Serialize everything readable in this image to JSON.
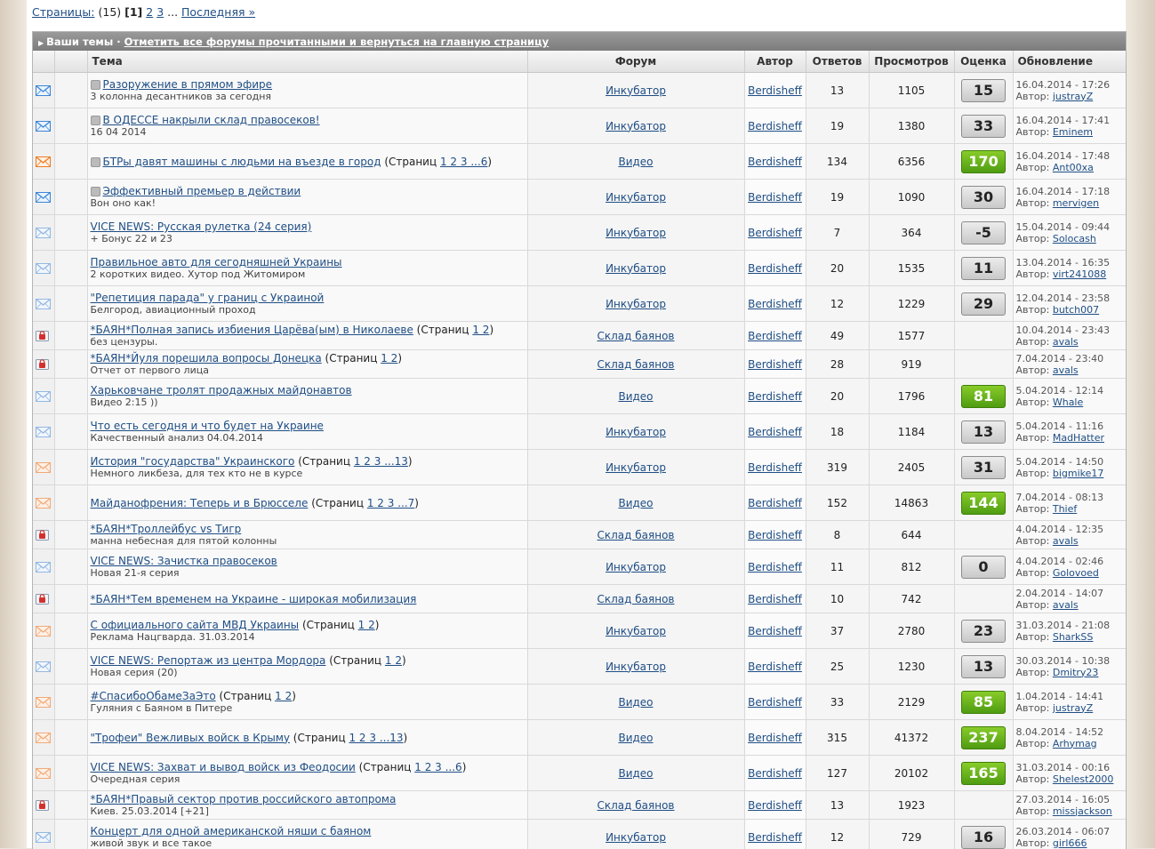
{
  "pager": {
    "label": "Страницы:",
    "count": "(15)",
    "current": "[1]",
    "p2": "2",
    "p3": "3",
    "dots": "...",
    "last": "Последняя »"
  },
  "bar": {
    "title": "Ваши темы",
    "sep": " · ",
    "mark_read": "Отметить все форумы прочитанными и вернуться на главную страницу"
  },
  "columns": {
    "topic": "Тема",
    "forum": "Форум",
    "author": "Автор",
    "replies": "Ответов",
    "views": "Просмотров",
    "rating": "Оценка",
    "updated": "Обновление"
  },
  "author_prefix": "Автор:",
  "pages_prefix": "(Страниц",
  "rows": [
    {
      "icon": "blue",
      "pin": true,
      "title": "Разоружение в прямом эфире",
      "pages": "",
      "desc": "3 колонна десантников за сегодня",
      "forum": "Инкубатор",
      "author": "Berdisheff",
      "replies": "13",
      "views": "1105",
      "rating": "15",
      "green": false,
      "date": "16.04.2014 - 17:26",
      "last": "justrayZ"
    },
    {
      "icon": "blue",
      "pin": true,
      "title": "В ОДЕССЕ накрыли склад правосеков!",
      "pages": "",
      "desc": "16 04 2014",
      "forum": "Инкубатор",
      "author": "Berdisheff",
      "replies": "19",
      "views": "1380",
      "rating": "33",
      "green": false,
      "date": "16.04.2014 - 17:41",
      "last": "Eminem"
    },
    {
      "icon": "orange",
      "pin": true,
      "title": "БТРы давят машины с людьми на въезде в город",
      "pages": "1 2 3 ...6",
      "desc": "",
      "forum": "Видео",
      "author": "Berdisheff",
      "replies": "134",
      "views": "6356",
      "rating": "170",
      "green": true,
      "date": "16.04.2014 - 17:48",
      "last": "Ant00xa"
    },
    {
      "icon": "blue",
      "pin": true,
      "title": "Эффективный премьер в действии",
      "pages": "",
      "desc": "Вон оно как!",
      "forum": "Инкубатор",
      "author": "Berdisheff",
      "replies": "19",
      "views": "1090",
      "rating": "30",
      "green": false,
      "date": "16.04.2014 - 17:18",
      "last": "mervigen"
    },
    {
      "icon": "lblue",
      "pin": false,
      "title": "VICE NEWS: Русская рулетка (24 серия)",
      "pages": "",
      "desc": "+ Бонус 22 и 23",
      "forum": "Инкубатор",
      "author": "Berdisheff",
      "replies": "7",
      "views": "364",
      "rating": "-5",
      "green": false,
      "date": "15.04.2014 - 09:44",
      "last": "Solocash"
    },
    {
      "icon": "lblue",
      "pin": false,
      "title": "Правильное авто для сегодняшней Украины",
      "pages": "",
      "desc": "2 коротких видео. Хутор под Житомиром",
      "forum": "Инкубатор",
      "author": "Berdisheff",
      "replies": "20",
      "views": "1535",
      "rating": "11",
      "green": false,
      "date": "13.04.2014 - 16:35",
      "last": "virt241088"
    },
    {
      "icon": "lblue",
      "pin": false,
      "title": "\"Репетиция парада\" у границ с Украиной",
      "pages": "",
      "desc": "Белгород, авиационный проход",
      "forum": "Инкубатор",
      "author": "Berdisheff",
      "replies": "12",
      "views": "1229",
      "rating": "29",
      "green": false,
      "date": "12.04.2014 - 23:58",
      "last": "butch007"
    },
    {
      "icon": "lock",
      "pin": false,
      "title": "*БАЯН*Полная запись избиения Царёва(ым) в Николаеве",
      "pages": "1 2",
      "desc": "без цензуры.",
      "forum": "Склад баянов",
      "author": "Berdisheff",
      "replies": "49",
      "views": "1577",
      "rating": "",
      "green": false,
      "date": "10.04.2014 - 23:43",
      "last": "avals"
    },
    {
      "icon": "lock",
      "pin": false,
      "title": "*БАЯН*Йуля порешила вопросы Донецка",
      "pages": "1 2",
      "desc": "Отчет от первого лица",
      "forum": "Склад баянов",
      "author": "Berdisheff",
      "replies": "28",
      "views": "919",
      "rating": "",
      "green": false,
      "date": "7.04.2014 - 23:40",
      "last": "avals"
    },
    {
      "icon": "lblue",
      "pin": false,
      "title": "Харьковчане тролят продажных майдонавтов",
      "pages": "",
      "desc": "Видео 2:15 ))",
      "forum": "Видео",
      "author": "Berdisheff",
      "replies": "20",
      "views": "1796",
      "rating": "81",
      "green": true,
      "date": "5.04.2014 - 12:14",
      "last": "Whale"
    },
    {
      "icon": "lblue",
      "pin": false,
      "title": "Что есть сегодня и что будет на Украине",
      "pages": "",
      "desc": "Качественный анализ 04.04.2014",
      "forum": "Инкубатор",
      "author": "Berdisheff",
      "replies": "18",
      "views": "1184",
      "rating": "13",
      "green": false,
      "date": "5.04.2014 - 11:16",
      "last": "MadHatter"
    },
    {
      "icon": "lorange",
      "pin": false,
      "title": "История \"государства\" Украинского",
      "pages": "1 2 3 ...13",
      "desc": "Немного ликбеза, для тех кто не в курсе",
      "forum": "Инкубатор",
      "author": "Berdisheff",
      "replies": "319",
      "views": "2405",
      "rating": "31",
      "green": false,
      "date": "5.04.2014 - 14:50",
      "last": "bigmike17"
    },
    {
      "icon": "lorange",
      "pin": false,
      "title": "Майданофрения: Теперь и в Брюсселе",
      "pages": "1 2 3 ...7",
      "desc": "",
      "forum": "Видео",
      "author": "Berdisheff",
      "replies": "152",
      "views": "14863",
      "rating": "144",
      "green": true,
      "date": "7.04.2014 - 08:13",
      "last": "Thief"
    },
    {
      "icon": "lock",
      "pin": false,
      "title": "*БАЯН*Троллейбус vs Тигр",
      "pages": "",
      "desc": "манна небесная для пятой колонны",
      "forum": "Склад баянов",
      "author": "Berdisheff",
      "replies": "8",
      "views": "644",
      "rating": "",
      "green": false,
      "date": "4.04.2014 - 12:35",
      "last": "avals"
    },
    {
      "icon": "lblue",
      "pin": false,
      "title": "VICE NEWS: Зачистка правосеков",
      "pages": "",
      "desc": "Новая 21-я серия",
      "forum": "Инкубатор",
      "author": "Berdisheff",
      "replies": "11",
      "views": "812",
      "rating": "0",
      "green": false,
      "date": "4.04.2014 - 02:46",
      "last": "Golovoed"
    },
    {
      "icon": "lock",
      "pin": false,
      "title": "*БАЯН*Тем временем на Украине - широкая мобилизация",
      "pages": "",
      "desc": "",
      "forum": "Склад баянов",
      "author": "Berdisheff",
      "replies": "10",
      "views": "742",
      "rating": "",
      "green": false,
      "date": "2.04.2014 - 14:07",
      "last": "avals"
    },
    {
      "icon": "lorange",
      "pin": false,
      "title": "С официального сайта МВД Украины",
      "pages": "1 2",
      "desc": "Реклама Нацгварда. 31.03.2014",
      "forum": "Инкубатор",
      "author": "Berdisheff",
      "replies": "37",
      "views": "2780",
      "rating": "23",
      "green": false,
      "date": "31.03.2014 - 21:08",
      "last": "SharkSS"
    },
    {
      "icon": "lblue",
      "pin": false,
      "title": "VICE NEWS: Репортаж из центра Мордора",
      "pages": "1 2",
      "desc": "Новая серия (20)",
      "forum": "Инкубатор",
      "author": "Berdisheff",
      "replies": "25",
      "views": "1230",
      "rating": "13",
      "green": false,
      "date": "30.03.2014 - 10:38",
      "last": "Dmitry23"
    },
    {
      "icon": "lorange",
      "pin": false,
      "title": "#СпасибоОбамеЗаЭто",
      "pages": "1 2",
      "desc": "Гуляния с Баяном в Питере",
      "forum": "Видео",
      "author": "Berdisheff",
      "replies": "33",
      "views": "2129",
      "rating": "85",
      "green": true,
      "date": "1.04.2014 - 14:41",
      "last": "justrayZ"
    },
    {
      "icon": "lorange",
      "pin": false,
      "title": "\"Трофеи\" Вежливых войск в Крыму",
      "pages": "1 2 3 ...13",
      "desc": "",
      "forum": "Видео",
      "author": "Berdisheff",
      "replies": "315",
      "views": "41372",
      "rating": "237",
      "green": true,
      "date": "8.04.2014 - 14:52",
      "last": "Arhymag"
    },
    {
      "icon": "lorange",
      "pin": false,
      "title": "VICE NEWS: Захват и вывод войск из Феодосии",
      "pages": "1 2 3 ...6",
      "desc": "Очередная серия",
      "forum": "Видео",
      "author": "Berdisheff",
      "replies": "127",
      "views": "20102",
      "rating": "165",
      "green": true,
      "date": "31.03.2014 - 00:16",
      "last": "Shelest2000"
    },
    {
      "icon": "lock",
      "pin": false,
      "title": "*БАЯН*Правый сектор против российского автопрома",
      "pages": "",
      "desc": "Киев. 25.03.2014 [+21]",
      "forum": "Склад баянов",
      "author": "Berdisheff",
      "replies": "13",
      "views": "1923",
      "rating": "",
      "green": false,
      "date": "27.03.2014 - 16:05",
      "last": "missjackson"
    },
    {
      "icon": "lblue",
      "pin": false,
      "title": "Концерт для одной американской няши с баяном",
      "pages": "",
      "desc": "живой звук и все такое",
      "forum": "Инкубатор",
      "author": "Berdisheff",
      "replies": "12",
      "views": "729",
      "rating": "16",
      "green": false,
      "date": "26.03.2014 - 06:07",
      "last": "girl666"
    }
  ]
}
